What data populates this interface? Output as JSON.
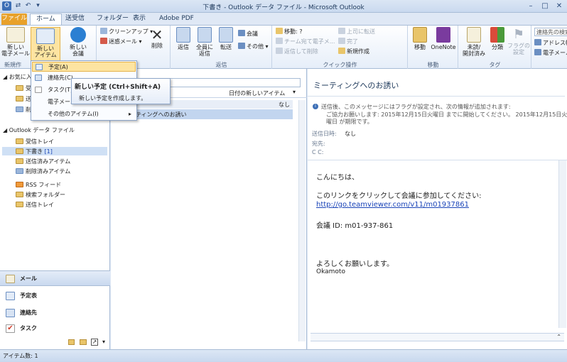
{
  "window": {
    "title": "下書き - Outlook データ ファイル - Microsoft Outlook",
    "minimize": "–",
    "maximize": "□",
    "close": "✕"
  },
  "tabs": [
    "ファイル",
    "ホーム",
    "送受信",
    "フォルダー",
    "表示",
    "Adobe PDF"
  ],
  "ribbon": {
    "new_email": "新しい\n電子メール",
    "new_item": "新しい\nアイテム",
    "new_meeting": "新しい\n会議",
    "group_new": "新規作",
    "cleanup": "クリーンアップ",
    "junk": "迷惑メール",
    "delete": "削除",
    "reply": "返信",
    "reply_all": "全員に\n返信",
    "forward": "転送",
    "meeting": "会議",
    "more": "その他",
    "group_respond": "返信",
    "group_delete": "除",
    "qs_move": "移動: ?",
    "qs_team": "チーム宛て電子メ...",
    "qs_reply_delete": "返信して削除",
    "qs_manager": "上司に転送",
    "qs_done": "完了",
    "qs_new": "新規作成",
    "group_quick": "クイック操作",
    "move": "移動",
    "onenote": "OneNote",
    "group_move": "移動",
    "unread": "未読/\n開封済み",
    "categorize": "分類",
    "followup": "フラグの\n設定",
    "group_tags": "タグ",
    "find_contact": "連絡先の検索",
    "address_book": "アドレス帳",
    "filter_email": "電子メール"
  },
  "nav": {
    "favorites": "お気に入り",
    "fav_items": [
      "受",
      "送",
      "削"
    ],
    "data_file": "Outlook データ ファイル",
    "folders": [
      "受信トレイ",
      "下書き",
      "送信済みアイテム",
      "削除済みアイテム",
      "RSS フィード",
      "検索フォルダー",
      "送信トレイ"
    ],
    "draft_count": "[1]",
    "buttons": [
      "メール",
      "予定表",
      "連絡先",
      "タスク"
    ]
  },
  "list": {
    "arrange_label": "日付の新しいアイテム",
    "group_label": "なし",
    "item_subject": "ティングへのお誘い"
  },
  "reading": {
    "subject": "ミーティングへのお誘い",
    "info_line1": "送信後、このメッセージにはフラグが設定され、次の情報が追加されます:",
    "info_line2": "ご協力お願いします: 2015年12月15日火曜日 までに開始してください。 2015年12月15日火",
    "info_line3": "曜日 が期限です。",
    "sent_label": "送信日時:",
    "sent_value": "なし",
    "to_label": "宛先:",
    "cc_label": "C C:",
    "body_greeting": "こんにちは、",
    "body_line": "このリンクをクリックして会議に参加してください:",
    "body_link": "http://go.teamviewer.com/v11/m01937861",
    "body_id": "会議 ID: m01-937-861",
    "body_closing": "よろしくお願いします。",
    "body_sign": "Okamoto"
  },
  "menu": {
    "items": [
      "予定(A)",
      "連絡先(C)",
      "タスク(T)",
      "電子メール",
      "その他のアイテム(I)"
    ],
    "tooltip_title": "新しい予定 (Ctrl+Shift+A)",
    "tooltip_desc": "新しい予定を作成します。"
  },
  "status": {
    "count": "アイテム数: 1"
  },
  "colors": {
    "accent": "#e8a12a",
    "highlight": "#fde4a1",
    "link": "#1a44b8"
  }
}
